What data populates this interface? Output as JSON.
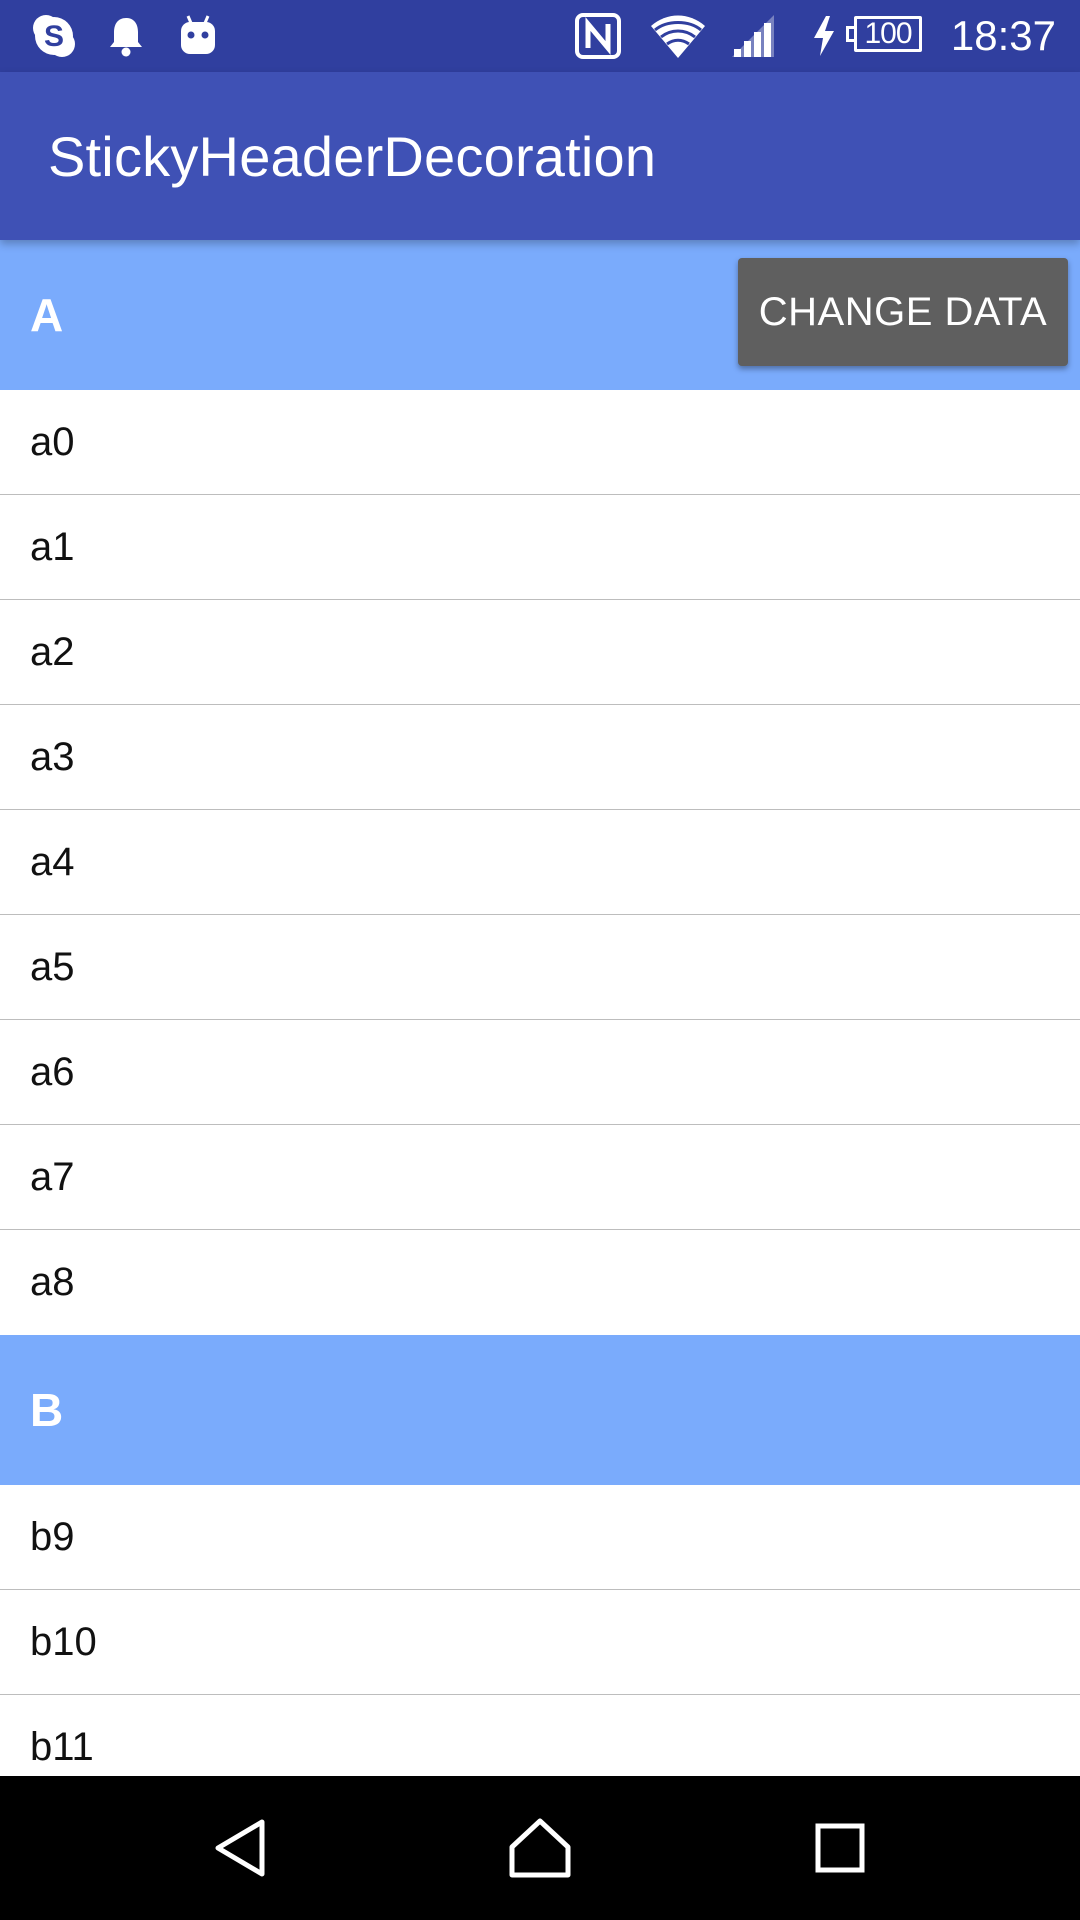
{
  "status_bar": {
    "time": "18:37",
    "battery_level": "100",
    "left_icons": [
      "skype-icon",
      "notification-bell-icon",
      "android-debug-icon"
    ],
    "right_icons": [
      "nfc-icon",
      "wifi-icon",
      "cell-signal-icon",
      "charging-icon",
      "battery-icon"
    ],
    "background_color": "#303f9f"
  },
  "app_bar": {
    "title": "StickyHeaderDecoration",
    "background_color": "#3f51b5"
  },
  "list": {
    "header_color": "#7aabfc",
    "sections": [
      {
        "letter": "A",
        "items": [
          "a0",
          "a1",
          "a2",
          "a3",
          "a4",
          "a5",
          "a6",
          "a7",
          "a8"
        ]
      },
      {
        "letter": "B",
        "items": [
          "b9",
          "b10",
          "b11"
        ]
      }
    ]
  },
  "change_data_button": {
    "label": "CHANGE DATA",
    "background_color": "#5f5f5f"
  },
  "nav_bar": {
    "buttons": [
      "back-icon",
      "home-icon",
      "recent-apps-icon"
    ]
  }
}
